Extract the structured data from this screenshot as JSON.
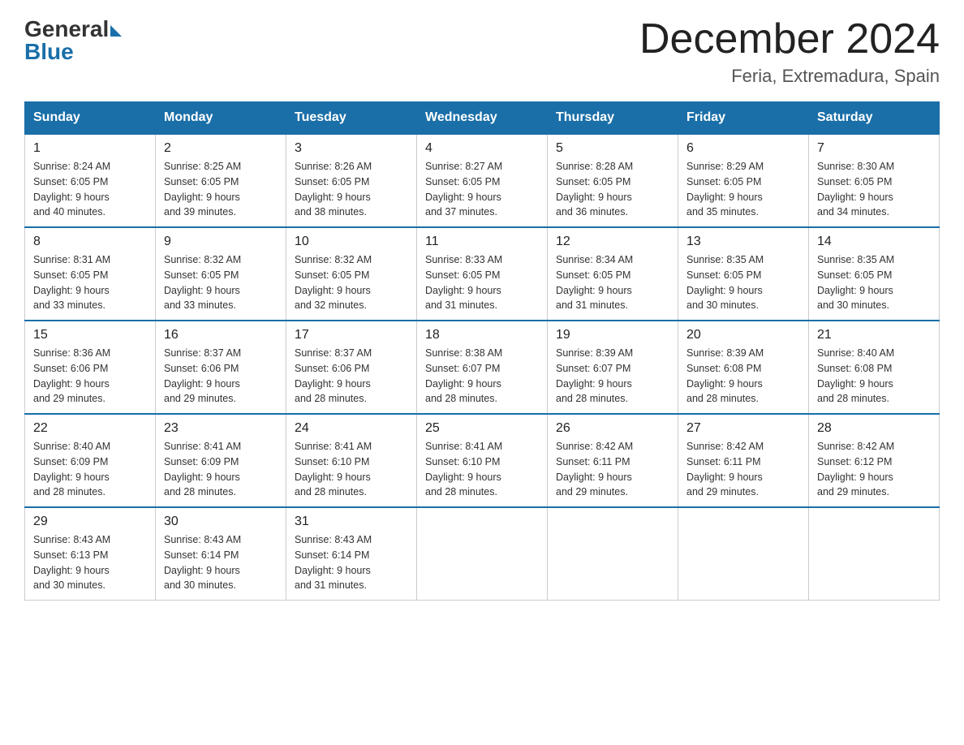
{
  "logo": {
    "general": "General",
    "blue": "Blue"
  },
  "title": {
    "month_year": "December 2024",
    "location": "Feria, Extremadura, Spain"
  },
  "headers": [
    "Sunday",
    "Monday",
    "Tuesday",
    "Wednesday",
    "Thursday",
    "Friday",
    "Saturday"
  ],
  "weeks": [
    [
      {
        "day": "1",
        "sunrise": "8:24 AM",
        "sunset": "6:05 PM",
        "daylight": "9 hours and 40 minutes."
      },
      {
        "day": "2",
        "sunrise": "8:25 AM",
        "sunset": "6:05 PM",
        "daylight": "9 hours and 39 minutes."
      },
      {
        "day": "3",
        "sunrise": "8:26 AM",
        "sunset": "6:05 PM",
        "daylight": "9 hours and 38 minutes."
      },
      {
        "day": "4",
        "sunrise": "8:27 AM",
        "sunset": "6:05 PM",
        "daylight": "9 hours and 37 minutes."
      },
      {
        "day": "5",
        "sunrise": "8:28 AM",
        "sunset": "6:05 PM",
        "daylight": "9 hours and 36 minutes."
      },
      {
        "day": "6",
        "sunrise": "8:29 AM",
        "sunset": "6:05 PM",
        "daylight": "9 hours and 35 minutes."
      },
      {
        "day": "7",
        "sunrise": "8:30 AM",
        "sunset": "6:05 PM",
        "daylight": "9 hours and 34 minutes."
      }
    ],
    [
      {
        "day": "8",
        "sunrise": "8:31 AM",
        "sunset": "6:05 PM",
        "daylight": "9 hours and 33 minutes."
      },
      {
        "day": "9",
        "sunrise": "8:32 AM",
        "sunset": "6:05 PM",
        "daylight": "9 hours and 33 minutes."
      },
      {
        "day": "10",
        "sunrise": "8:32 AM",
        "sunset": "6:05 PM",
        "daylight": "9 hours and 32 minutes."
      },
      {
        "day": "11",
        "sunrise": "8:33 AM",
        "sunset": "6:05 PM",
        "daylight": "9 hours and 31 minutes."
      },
      {
        "day": "12",
        "sunrise": "8:34 AM",
        "sunset": "6:05 PM",
        "daylight": "9 hours and 31 minutes."
      },
      {
        "day": "13",
        "sunrise": "8:35 AM",
        "sunset": "6:05 PM",
        "daylight": "9 hours and 30 minutes."
      },
      {
        "day": "14",
        "sunrise": "8:35 AM",
        "sunset": "6:05 PM",
        "daylight": "9 hours and 30 minutes."
      }
    ],
    [
      {
        "day": "15",
        "sunrise": "8:36 AM",
        "sunset": "6:06 PM",
        "daylight": "9 hours and 29 minutes."
      },
      {
        "day": "16",
        "sunrise": "8:37 AM",
        "sunset": "6:06 PM",
        "daylight": "9 hours and 29 minutes."
      },
      {
        "day": "17",
        "sunrise": "8:37 AM",
        "sunset": "6:06 PM",
        "daylight": "9 hours and 28 minutes."
      },
      {
        "day": "18",
        "sunrise": "8:38 AM",
        "sunset": "6:07 PM",
        "daylight": "9 hours and 28 minutes."
      },
      {
        "day": "19",
        "sunrise": "8:39 AM",
        "sunset": "6:07 PM",
        "daylight": "9 hours and 28 minutes."
      },
      {
        "day": "20",
        "sunrise": "8:39 AM",
        "sunset": "6:08 PM",
        "daylight": "9 hours and 28 minutes."
      },
      {
        "day": "21",
        "sunrise": "8:40 AM",
        "sunset": "6:08 PM",
        "daylight": "9 hours and 28 minutes."
      }
    ],
    [
      {
        "day": "22",
        "sunrise": "8:40 AM",
        "sunset": "6:09 PM",
        "daylight": "9 hours and 28 minutes."
      },
      {
        "day": "23",
        "sunrise": "8:41 AM",
        "sunset": "6:09 PM",
        "daylight": "9 hours and 28 minutes."
      },
      {
        "day": "24",
        "sunrise": "8:41 AM",
        "sunset": "6:10 PM",
        "daylight": "9 hours and 28 minutes."
      },
      {
        "day": "25",
        "sunrise": "8:41 AM",
        "sunset": "6:10 PM",
        "daylight": "9 hours and 28 minutes."
      },
      {
        "day": "26",
        "sunrise": "8:42 AM",
        "sunset": "6:11 PM",
        "daylight": "9 hours and 29 minutes."
      },
      {
        "day": "27",
        "sunrise": "8:42 AM",
        "sunset": "6:11 PM",
        "daylight": "9 hours and 29 minutes."
      },
      {
        "day": "28",
        "sunrise": "8:42 AM",
        "sunset": "6:12 PM",
        "daylight": "9 hours and 29 minutes."
      }
    ],
    [
      {
        "day": "29",
        "sunrise": "8:43 AM",
        "sunset": "6:13 PM",
        "daylight": "9 hours and 30 minutes."
      },
      {
        "day": "30",
        "sunrise": "8:43 AM",
        "sunset": "6:14 PM",
        "daylight": "9 hours and 30 minutes."
      },
      {
        "day": "31",
        "sunrise": "8:43 AM",
        "sunset": "6:14 PM",
        "daylight": "9 hours and 31 minutes."
      },
      null,
      null,
      null,
      null
    ]
  ],
  "labels": {
    "sunrise": "Sunrise:",
    "sunset": "Sunset:",
    "daylight": "Daylight:"
  }
}
